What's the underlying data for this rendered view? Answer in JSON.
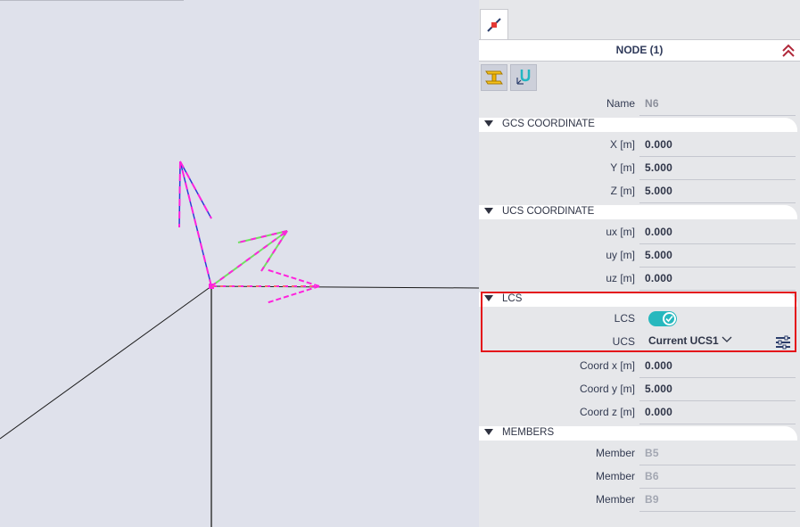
{
  "panel": {
    "header_title": "NODE (1)",
    "name": {
      "label": "Name",
      "value": "N6"
    },
    "gcs": {
      "title": "GCS COORDINATE",
      "rows": [
        {
          "label": "X [m]",
          "value": "0.000"
        },
        {
          "label": "Y [m]",
          "value": "5.000"
        },
        {
          "label": "Z [m]",
          "value": "5.000"
        }
      ]
    },
    "ucs": {
      "title": "UCS COORDINATE",
      "rows": [
        {
          "label": "ux [m]",
          "value": "0.000"
        },
        {
          "label": "uy [m]",
          "value": "5.000"
        },
        {
          "label": "uz [m]",
          "value": "0.000"
        }
      ]
    },
    "lcs": {
      "title": "LCS",
      "toggle_label": "LCS",
      "toggle_on": true,
      "ucs_label": "UCS",
      "ucs_value": "Current UCS1",
      "rows": [
        {
          "label": "Coord x [m]",
          "value": "0.000"
        },
        {
          "label": "Coord y [m]",
          "value": "5.000"
        },
        {
          "label": "Coord z [m]",
          "value": "0.000"
        }
      ]
    },
    "members": {
      "title": "MEMBERS",
      "rows": [
        {
          "label": "Member",
          "value": "B5"
        },
        {
          "label": "Member",
          "value": "B6"
        },
        {
          "label": "Member",
          "value": "B9"
        }
      ]
    }
  },
  "icons": {
    "tab": "node-icon",
    "collapse": "chevron-up-icon",
    "toolbar": [
      "beam-section-icon",
      "ucs-axis-icon"
    ],
    "settings": "settings-sliders-icon"
  },
  "colors": {
    "highlight_box": "#e4121a",
    "toggle": "#27b8be",
    "arrow_magenta": "#ff22dd",
    "arrow_green": "#70e060",
    "axis_blue": "#2b3bd4"
  }
}
